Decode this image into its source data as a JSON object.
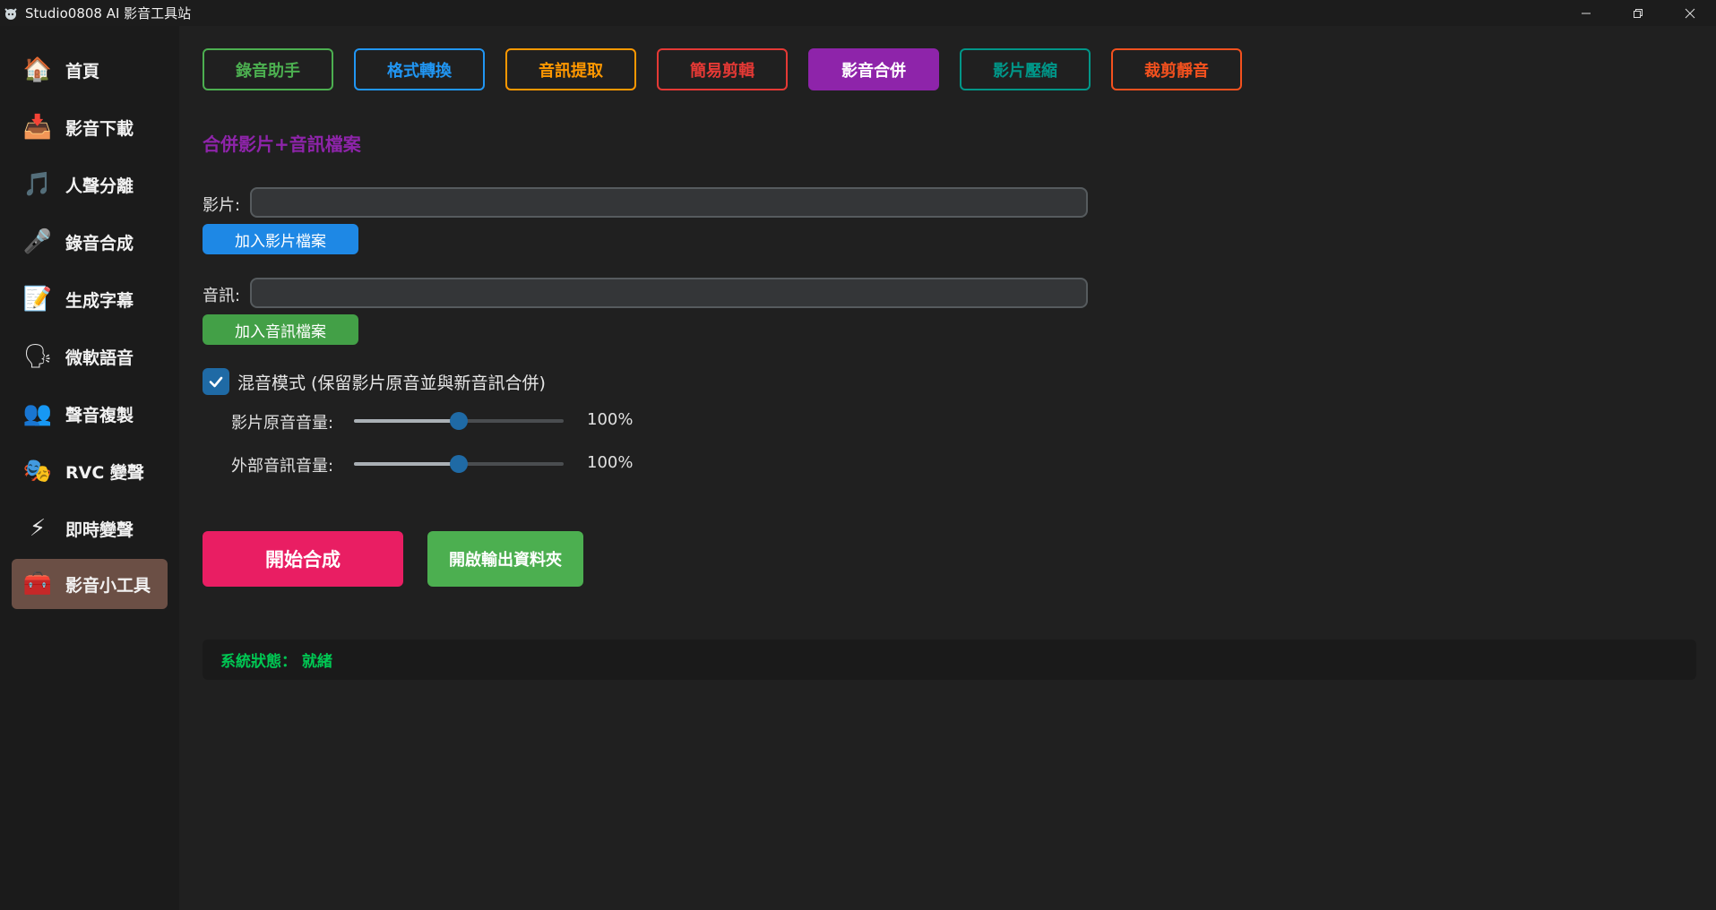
{
  "window": {
    "title": "Studio0808 AI 影音工具站",
    "controls": [
      "minimize-icon",
      "restore-icon",
      "close-icon"
    ]
  },
  "sidebar": {
    "items": [
      {
        "label": "首頁",
        "icon": "house-icon"
      },
      {
        "label": "影音下載",
        "icon": "download-tray-icon"
      },
      {
        "label": "人聲分離",
        "icon": "music-note-icon"
      },
      {
        "label": "錄音合成",
        "icon": "microphone-icon"
      },
      {
        "label": "生成字幕",
        "icon": "memo-icon"
      },
      {
        "label": "微軟語音",
        "icon": "speaking-head-icon"
      },
      {
        "label": "聲音複製",
        "icon": "people-icon"
      },
      {
        "label": "RVC 變聲",
        "icon": "theater-masks-icon"
      },
      {
        "label": "即時變聲",
        "icon": "lightning-icon"
      },
      {
        "label": "影音小工具",
        "icon": "toolbox-icon"
      }
    ],
    "active_index": 9
  },
  "tabs": [
    {
      "label": "錄音助手",
      "color": "#4caf50"
    },
    {
      "label": "格式轉換",
      "color": "#2196f3"
    },
    {
      "label": "音訊提取",
      "color": "#ff9800"
    },
    {
      "label": "簡易剪輯",
      "color": "#e53935"
    },
    {
      "label": "影音合併",
      "color": "#8e24aa"
    },
    {
      "label": "影片壓縮",
      "color": "#009688"
    },
    {
      "label": "裁剪靜音",
      "color": "#f4511e"
    }
  ],
  "active_tab_index": 4,
  "section_title": "合併影片+音訊檔案",
  "video": {
    "label": "影片:",
    "value": "",
    "button": "加入影片檔案"
  },
  "audio": {
    "label": "音訊:",
    "value": "",
    "button": "加入音訊檔案"
  },
  "mix": {
    "checked": true,
    "label": "混音模式 (保留影片原音並與新音訊合併)",
    "original_volume": {
      "label": "影片原音音量:",
      "value": "100%",
      "level": 0.5
    },
    "external_volume": {
      "label": "外部音訊音量:",
      "value": "100%",
      "level": 0.5
    }
  },
  "actions": {
    "start": "開始合成",
    "open_folder": "開啟輸出資料夾"
  },
  "status": {
    "text": "系統狀態： 就緒"
  },
  "colors": {
    "accent_blue": "#1f6aa5",
    "start_button": "#e91e63",
    "open_folder_button": "#4caf50",
    "status_green": "#00c853"
  }
}
